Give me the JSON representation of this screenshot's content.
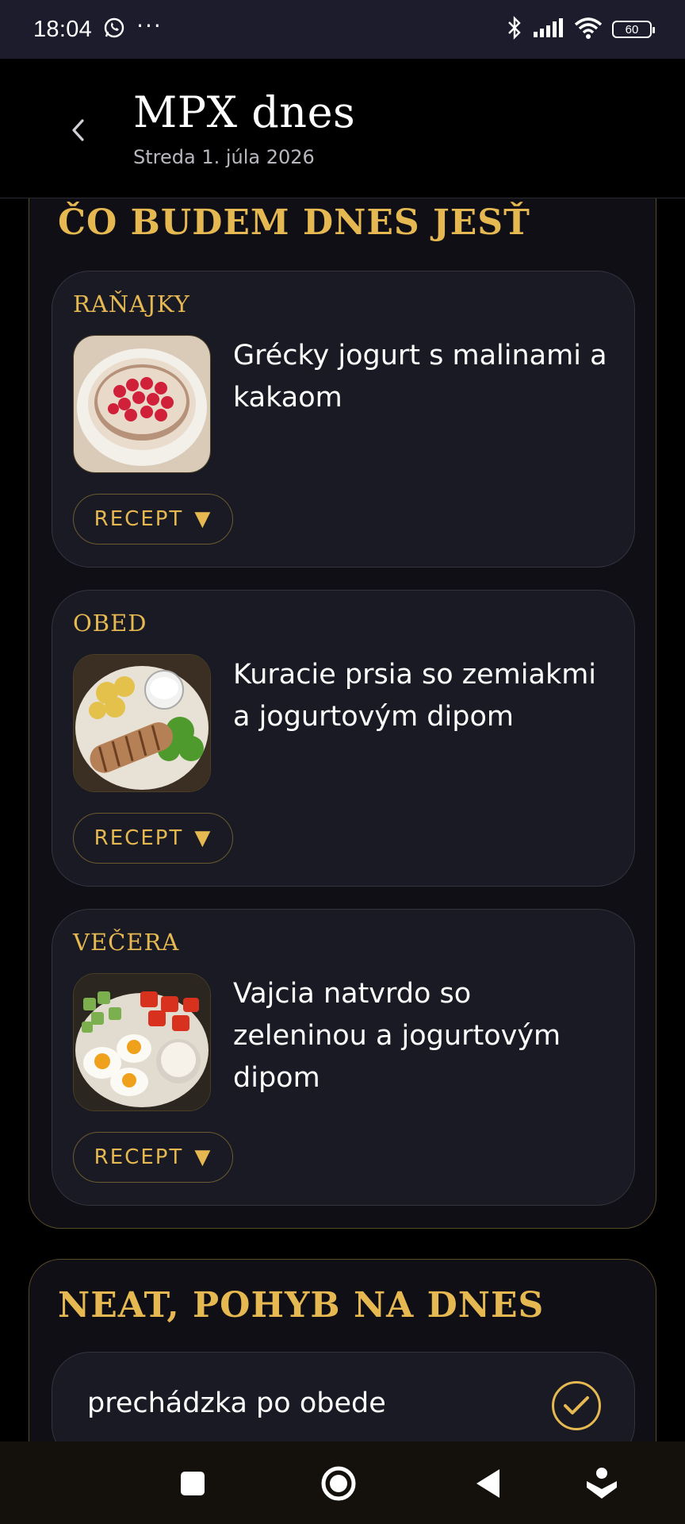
{
  "status_bar": {
    "time": "18:04",
    "battery": "60",
    "icons": [
      "whatsapp-icon",
      "more-dots-icon",
      "bluetooth-icon",
      "signal-icon",
      "wifi-icon",
      "battery-icon"
    ]
  },
  "header": {
    "title": "MPX dnes",
    "subtitle": "Streda 1. júla 2026"
  },
  "meals_section": {
    "title": "ČO BUDEM DNES JESŤ",
    "meals": [
      {
        "label": "RAŇAJKY",
        "name": "Grécky jogurt s malinami a kakaom",
        "recipe": "RECEPT",
        "arrow": "▼"
      },
      {
        "label": "OBED",
        "name": "Kuracie prsia so zemiakmi a jogurtovým dipom",
        "recipe": "RECEPT",
        "arrow": "▼"
      },
      {
        "label": "VEČERA",
        "name": "Vajcia natvrdo so zeleninou a jogurtovým dipom",
        "recipe": "RECEPT",
        "arrow": "▼"
      }
    ]
  },
  "neat_section": {
    "title": "NEAT, POHYB NA DNES",
    "items": [
      {
        "text": "prechádzka po obede",
        "checked": true
      }
    ]
  },
  "nav_bar": [
    "recents-icon",
    "home-icon",
    "back-icon",
    "accessibility-icon"
  ],
  "colors": {
    "accent": "#e5b851",
    "card": "#1a1a24",
    "panel": "#0f0f15"
  }
}
